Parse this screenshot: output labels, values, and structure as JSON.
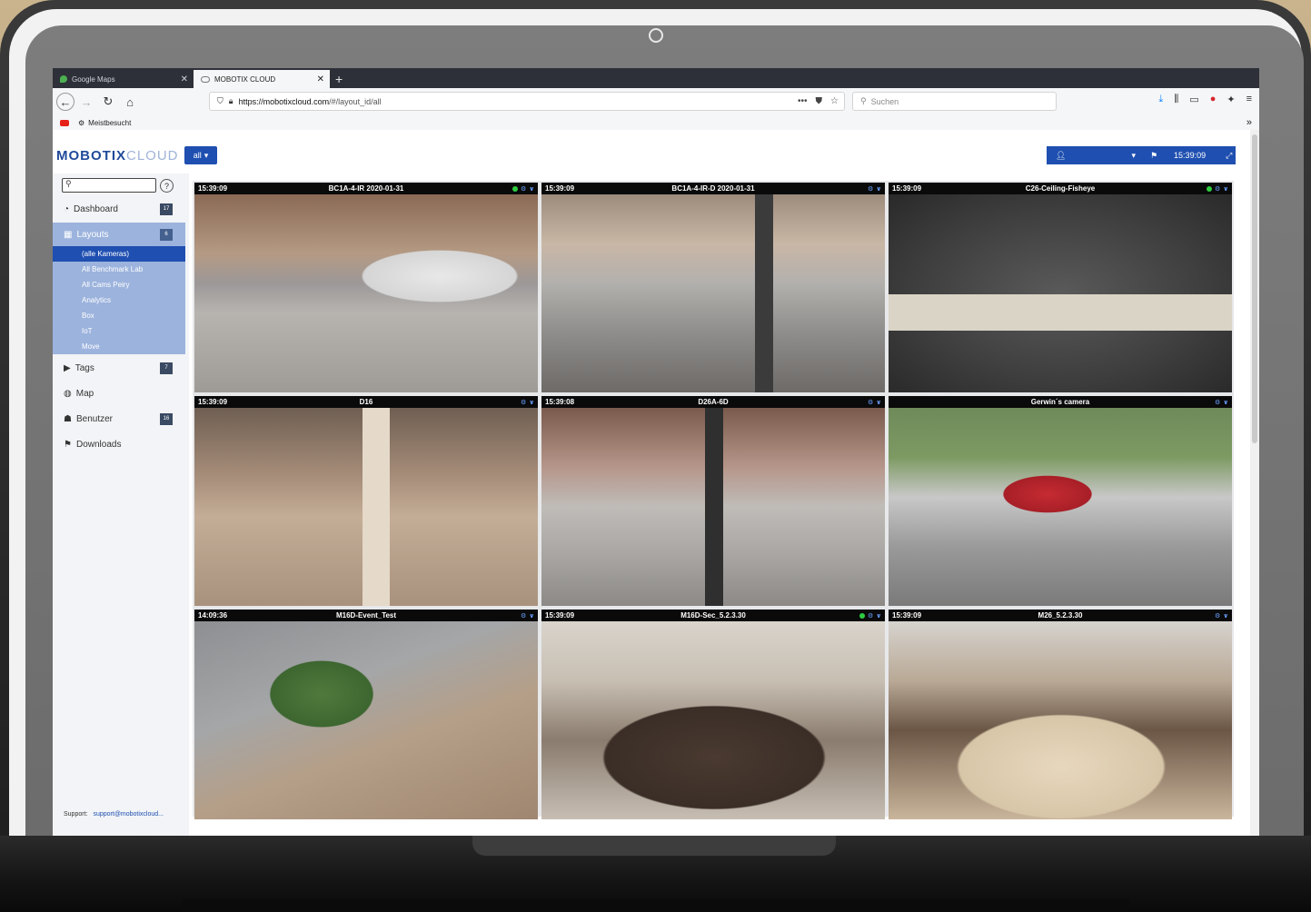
{
  "browser": {
    "tabs": [
      {
        "label": "Google Maps",
        "active": false
      },
      {
        "label": "MOBOTIX CLOUD",
        "active": true
      }
    ],
    "new_tab": "+",
    "url_host": "https://mobotixcloud.com",
    "url_path": "/#/layout_id/all",
    "search_placeholder": "Suchen",
    "bookmark_label": "Meistbesucht"
  },
  "app": {
    "logo_bold": "MOBOTIX",
    "logo_light": "CLOUD",
    "scope_button": "all",
    "header_time": "15:39:09"
  },
  "sidebar": {
    "search_value": "",
    "help": "?",
    "items": [
      {
        "label": "Dashboard",
        "badge": "17",
        "icon": "dashboard-icon"
      },
      {
        "label": "Layouts",
        "badge": "6",
        "icon": "layouts-icon"
      },
      {
        "label": "Tags",
        "badge": "7",
        "icon": "video-camera-icon"
      },
      {
        "label": "Map",
        "badge": "",
        "icon": "globe-icon"
      },
      {
        "label": "Benutzer",
        "badge": "16",
        "icon": "users-icon"
      },
      {
        "label": "Downloads",
        "badge": "",
        "icon": "flag-icon"
      }
    ],
    "layouts": [
      "(alle Kameras)",
      "All Benchmark Lab",
      "All Cams Peiry",
      "Analytics",
      "Box",
      "IoT",
      "Move"
    ],
    "support_label": "Support:",
    "support_link": "support@mobotixcloud..."
  },
  "cameras": [
    {
      "time": "15:39:09",
      "name": "BC1A-4-IR 2020-01-31",
      "status": "online",
      "scene": "mall-atrium"
    },
    {
      "time": "15:39:09",
      "name": "BC1A-4-IR-D 2020-01-31",
      "status": "streaming",
      "scene": "mall-corridor"
    },
    {
      "time": "15:39:09",
      "name": "C26-Ceiling-Fisheye",
      "status": "online",
      "scene": "fisheye-desk"
    },
    {
      "time": "15:39:09",
      "name": "D16",
      "status": "streaming",
      "scene": "mall-columns"
    },
    {
      "time": "15:39:08",
      "name": "D26A-6D",
      "status": "streaming",
      "scene": "mall-shops"
    },
    {
      "time": "",
      "name": "Gerwin´s camera",
      "status": "streaming",
      "scene": "parking-lot"
    },
    {
      "time": "14:09:36",
      "name": "M16D-Event_Test",
      "status": "streaming",
      "scene": "parking-aerial"
    },
    {
      "time": "15:39:09",
      "name": "M16D-Sec_5.2.3.30",
      "status": "online",
      "scene": "clothing-store"
    },
    {
      "time": "15:39:09",
      "name": "M26_5.2.3.30",
      "status": "streaming",
      "scene": "furniture-store"
    }
  ],
  "colors": {
    "brand_blue": "#1f4fb0",
    "sidebar_active": "#9cb3dd",
    "camera_bar": "#0a0a0a"
  }
}
